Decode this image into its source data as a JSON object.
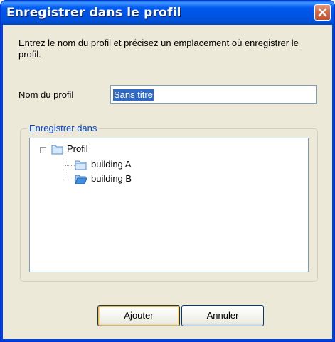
{
  "window": {
    "title": "Enregistrer dans le profil"
  },
  "dialog": {
    "instructions": "Entrez le nom du profil et précisez un emplacement où enregistrer le profil.",
    "name_label": "Nom du profil",
    "name_value": "Sans titre",
    "group_label": "Enregistrer dans"
  },
  "tree": {
    "root": {
      "label": "Profil",
      "expanded": true,
      "icon": "folder-icon"
    },
    "children": [
      {
        "label": "building A",
        "icon": "folder-icon"
      },
      {
        "label": "building B",
        "icon": "folder-open-icon"
      }
    ]
  },
  "buttons": {
    "add_label": "Ajouter",
    "cancel_label": "Annuler"
  },
  "colors": {
    "titlebar": "#0054e3",
    "face": "#ece9d8",
    "selection": "#316ac5",
    "group_label": "#0046d5",
    "close": "#d76e49"
  }
}
